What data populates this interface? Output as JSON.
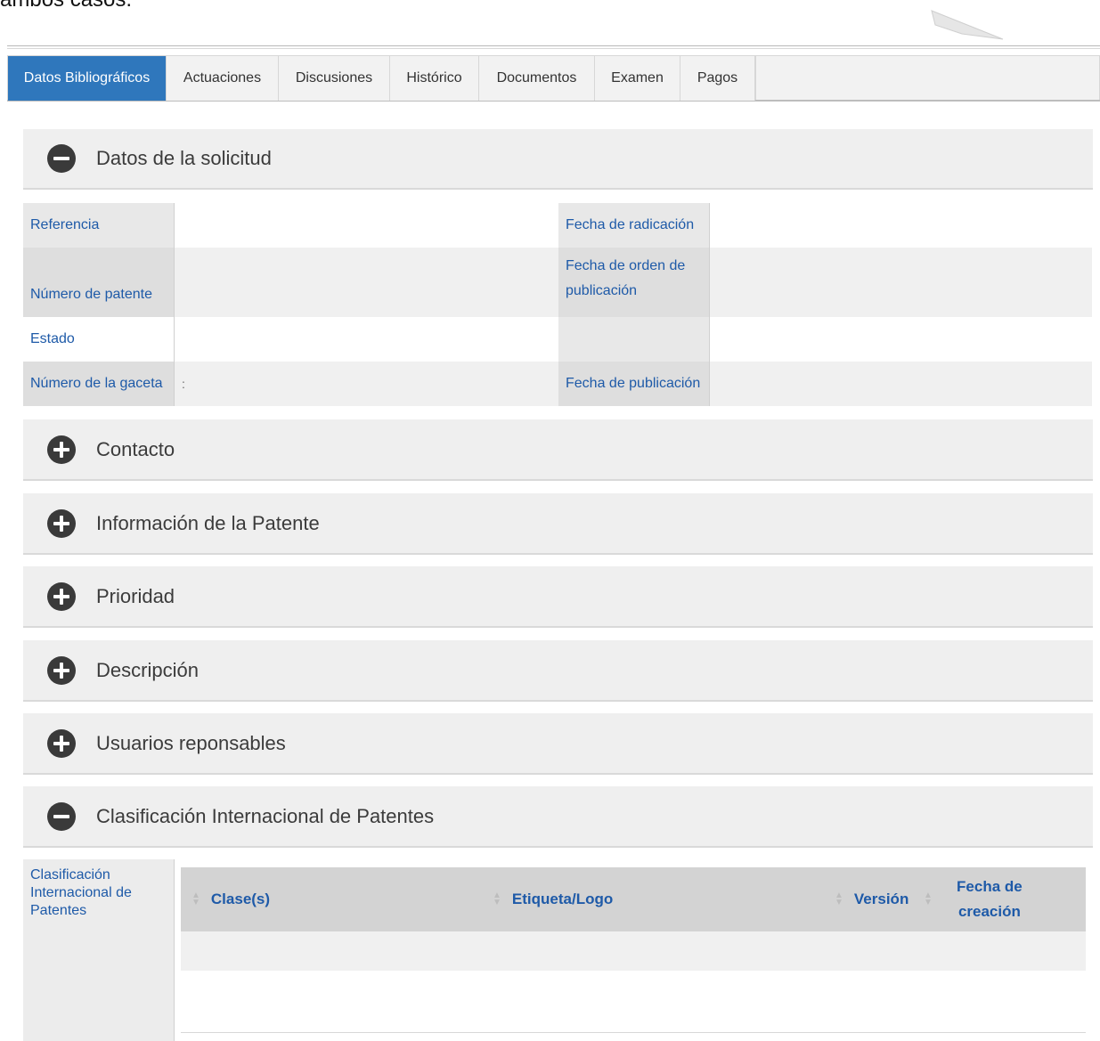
{
  "top_text": "ambos casos.",
  "tabs": [
    {
      "label": "Datos Bibliográficos"
    },
    {
      "label": "Actuaciones"
    },
    {
      "label": "Discusiones"
    },
    {
      "label": "Histórico"
    },
    {
      "label": "Documentos"
    },
    {
      "label": "Examen"
    },
    {
      "label": "Pagos"
    }
  ],
  "sections": {
    "solicitud": "Datos de la solicitud",
    "contacto": "Contacto",
    "informacion": "Información de la Patente",
    "prioridad": "Prioridad",
    "descripcion": "Descripción",
    "usuarios": "Usuarios reponsables",
    "clasificacion": "Clasificación Internacional de Patentes"
  },
  "solicitud_fields": {
    "referencia": "Referencia",
    "fecha_radicacion": "Fecha de radicación",
    "numero_patente": "Número de patente",
    "fecha_orden": "Fecha de orden de publicación",
    "estado": "Estado",
    "numero_gaceta": "Número de la gaceta",
    "numero_gaceta_value": ":",
    "fecha_publicacion": "Fecha de publicación"
  },
  "clasificacion": {
    "label": "Clasificación Internacional de Patentes",
    "columns": [
      "Clase(s)",
      "Etiqueta/Logo",
      "Versión",
      "Fecha de creación"
    ]
  }
}
